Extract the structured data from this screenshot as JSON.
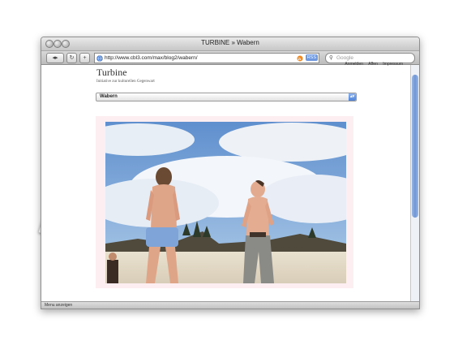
{
  "browser": {
    "window_title": "TURBINE » Wabern",
    "url": "http://www.cbl3.com/max/blog2/wabern/",
    "search_placeholder": "Google",
    "rss_badge": "RSS",
    "status_text": "Menu anzeigen"
  },
  "site": {
    "title": "Turbine",
    "subtitle": "Initiative zur kulturellen Gegenwart",
    "nav": [
      "Anmelden",
      "Affen",
      "Impressum"
    ],
    "select_value": "Wabern"
  },
  "colors": {
    "accent_blue": "#5b8ddd",
    "frame_pink": "#fdeef1",
    "sky": "#6e9fd6"
  },
  "icons": {
    "back": "back-arrow-icon",
    "forward": "forward-arrow-icon",
    "reload": "reload-icon",
    "add": "plus-icon",
    "site": "globe-icon",
    "feed": "rss-icon",
    "search": "magnifier-icon"
  }
}
